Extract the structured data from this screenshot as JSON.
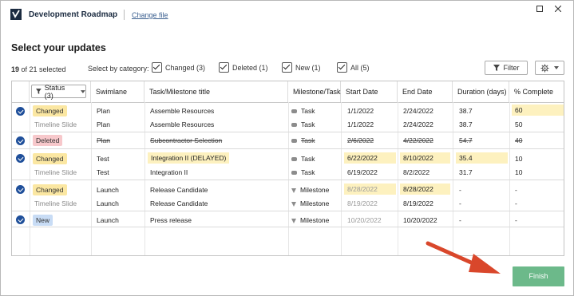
{
  "app": {
    "title": "Development Roadmap",
    "change_file": "Change file"
  },
  "heading": "Select your updates",
  "selection": {
    "count": "19",
    "suffix": " of 21 selected"
  },
  "category": {
    "label": "Select by category:",
    "options": [
      {
        "label": "Changed (3)"
      },
      {
        "label": "Deleted (1)"
      },
      {
        "label": "New (1)"
      },
      {
        "label": "All (5)"
      }
    ]
  },
  "toolbar": {
    "filter_label": "Filter"
  },
  "table": {
    "headers": {
      "status": "Status (3)",
      "swimlane": "Swimlane",
      "title": "Task/Milestone title",
      "type": "Milestone/Task",
      "start": "Start Date",
      "end": "End Date",
      "duration": "Duration (days)",
      "complete": "% Complete"
    },
    "rows": [
      {
        "status": "Changed",
        "swimlane": "Plan",
        "title": "Assemble Resources",
        "type": "Task",
        "start": "1/1/2022",
        "end": "2/24/2022",
        "duration": "38.7",
        "complete": "60"
      },
      {
        "status": "Timeline Slide",
        "swimlane": "Plan",
        "title": "Assemble Resources",
        "type": "Task",
        "start": "1/1/2022",
        "end": "2/24/2022",
        "duration": "38.7",
        "complete": "50"
      },
      {
        "status": "Deleted",
        "swimlane": "Plan",
        "title": "Subcontractor Selection",
        "type": "Task",
        "start": "2/6/2022",
        "end": "4/22/2022",
        "duration": "54.7",
        "complete": "40"
      },
      {
        "status": "Changed",
        "swimlane": "Test",
        "title": "Integration II (DELAYED)",
        "type": "Task",
        "start": "6/22/2022",
        "end": "8/10/2022",
        "duration": "35.4",
        "complete": "10"
      },
      {
        "status": "Timeline Slide",
        "swimlane": "Test",
        "title": "Integration II",
        "type": "Task",
        "start": "6/19/2022",
        "end": "8/2/2022",
        "duration": "31.7",
        "complete": "10"
      },
      {
        "status": "Changed",
        "swimlane": "Launch",
        "title": "Release Candidate",
        "type": "Milestone",
        "start": "8/28/2022",
        "end": "8/28/2022",
        "duration": "-",
        "complete": "-"
      },
      {
        "status": "Timeline Slide",
        "swimlane": "Launch",
        "title": "Release Candidate",
        "type": "Milestone",
        "start": "8/19/2022",
        "end": "8/19/2022",
        "duration": "-",
        "complete": "-"
      },
      {
        "status": "New",
        "swimlane": "Launch",
        "title": "Press release",
        "type": "Milestone",
        "start": "10/20/2022",
        "end": "10/20/2022",
        "duration": "-",
        "complete": "-"
      }
    ]
  },
  "footer": {
    "finish_label": "Finish"
  },
  "colors": {
    "accent": "#1f4f9a",
    "finish": "#6cb98a",
    "changed": "#fbe7a2",
    "deleted": "#f7c8cb",
    "new": "#c8dcf5",
    "arrow": "#d9472b"
  }
}
